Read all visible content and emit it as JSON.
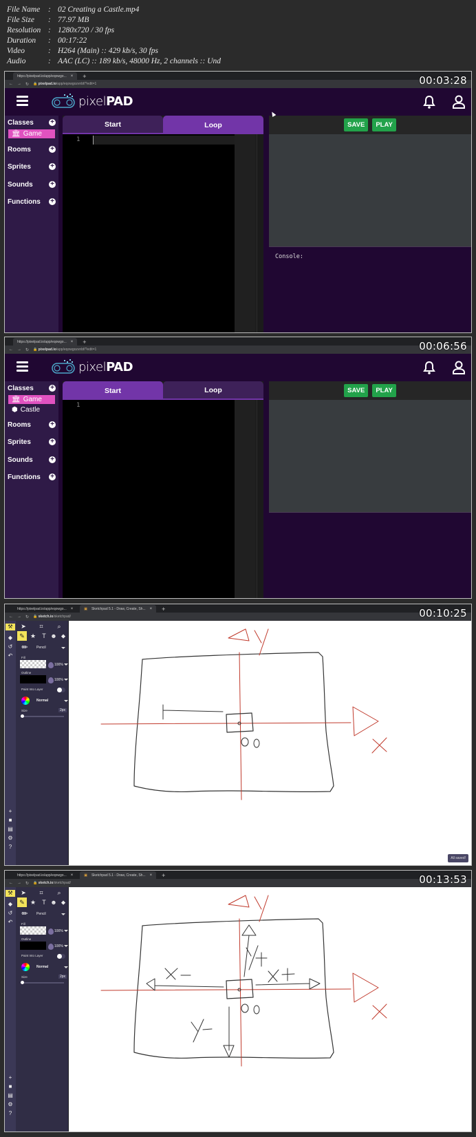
{
  "file_info": [
    {
      "key": "File Name",
      "value": "02 Creating a Castle.mp4"
    },
    {
      "key": "File Size",
      "value": "77.97 MB"
    },
    {
      "key": "Resolution",
      "value": "1280x720 / 30 fps"
    },
    {
      "key": "Duration",
      "value": "00:17:22"
    },
    {
      "key": "Video",
      "value": "H264 (Main) :: 429 kb/s, 30 fps"
    },
    {
      "key": "Audio",
      "value": "AAC (LC) :: 189 kb/s, 48000 Hz, 2 channels :: Und"
    }
  ],
  "frames": [
    {
      "timestamp": "00:03:28",
      "browser": {
        "tab": "https://pixelpad.io/app/eqowgo...",
        "url_host": "pixelpad.io",
        "url_path": "/app/eqowgozvnbf/?edit=1"
      },
      "app": {
        "logo_light": "pixel",
        "logo_bold": "PAD",
        "sidebar": [
          {
            "label": "Classes",
            "add": "+"
          },
          {
            "label": "Rooms",
            "add": "+"
          },
          {
            "label": "Sprites",
            "add": "+"
          },
          {
            "label": "Sounds",
            "add": "+"
          },
          {
            "label": "Functions",
            "add": "+"
          }
        ],
        "classes": [
          {
            "label": "Game",
            "icon": "institution-icon",
            "selected": true
          }
        ],
        "tabs": [
          {
            "label": "Start",
            "active": false
          },
          {
            "label": "Loop",
            "active": true
          }
        ],
        "line_number": "1",
        "buttons": {
          "save": "SAVE",
          "play": "PLAY"
        },
        "console_label": "Console:"
      }
    },
    {
      "timestamp": "00:06:56",
      "browser": {
        "tab": "https://pixelpad.io/app/eqowgo...",
        "url_host": "pixelpad.io",
        "url_path": "/app/eqowgozvnbf/?edit=1"
      },
      "app": {
        "logo_light": "pixel",
        "logo_bold": "PAD",
        "sidebar": [
          {
            "label": "Classes",
            "add": "+"
          },
          {
            "label": "Rooms",
            "add": "+"
          },
          {
            "label": "Sprites",
            "add": "+"
          },
          {
            "label": "Sounds",
            "add": "+"
          },
          {
            "label": "Functions",
            "add": "+"
          }
        ],
        "classes": [
          {
            "label": "Game",
            "icon": "institution-icon",
            "selected": true
          },
          {
            "label": "Castle",
            "icon": "cube-icon",
            "selected": false
          }
        ],
        "tabs": [
          {
            "label": "Start",
            "active": true
          },
          {
            "label": "Loop",
            "active": false
          }
        ],
        "line_number": "1",
        "buttons": {
          "save": "SAVE",
          "play": "PLAY"
        }
      }
    },
    {
      "timestamp": "00:10:25",
      "browser": {
        "tabs": [
          "https://pixelpad.io/app/eqowgo...",
          "Sketchpad 5.1 - Draw, Create, Sh..."
        ],
        "url_host": "sketch.io",
        "url_path": "/sketchpad/"
      },
      "sketchpad": {
        "tool": "Pencil",
        "fill_label": "Fill",
        "fill_opacity": "100%",
        "outline_label": "Outline",
        "outline_opacity": "100%",
        "paint_into_layer": "Paint Into Layer",
        "blend": "Normal",
        "size_label": "Size",
        "size_value": "2px",
        "toast": "All saved!"
      },
      "drawing_labels": {
        "y_axis": "y",
        "x_axis": "X",
        "origin": "0,0"
      }
    },
    {
      "timestamp": "00:13:53",
      "browser": {
        "tabs": [
          "https://pixelpad.io/app/eqowgo...",
          "Sketchpad 5.1 - Draw, Create, Sh..."
        ],
        "url_host": "sketch.io",
        "url_path": "/sketchpad/"
      },
      "sketchpad": {
        "tool": "Pencil",
        "fill_label": "Fill",
        "fill_opacity": "100%",
        "outline_label": "Outline",
        "outline_opacity": "100%",
        "paint_into_layer": "Paint Into Layer",
        "blend": "Normal",
        "size_label": "Size",
        "size_value": "2px"
      },
      "drawing_labels": {
        "y_axis": "y",
        "x_axis": "X",
        "origin": "0,0",
        "x_minus": "X−",
        "x_plus": "X+",
        "y_plus": "y+",
        "y_minus": "y−"
      }
    }
  ],
  "colors": {
    "pixelpad_bg": "#200732",
    "sidebar": "#2f1a47",
    "tab_active": "#7235a8",
    "class_selected": "#e052c0",
    "button_green": "#22a24a",
    "axis_red": "#c0392b"
  }
}
